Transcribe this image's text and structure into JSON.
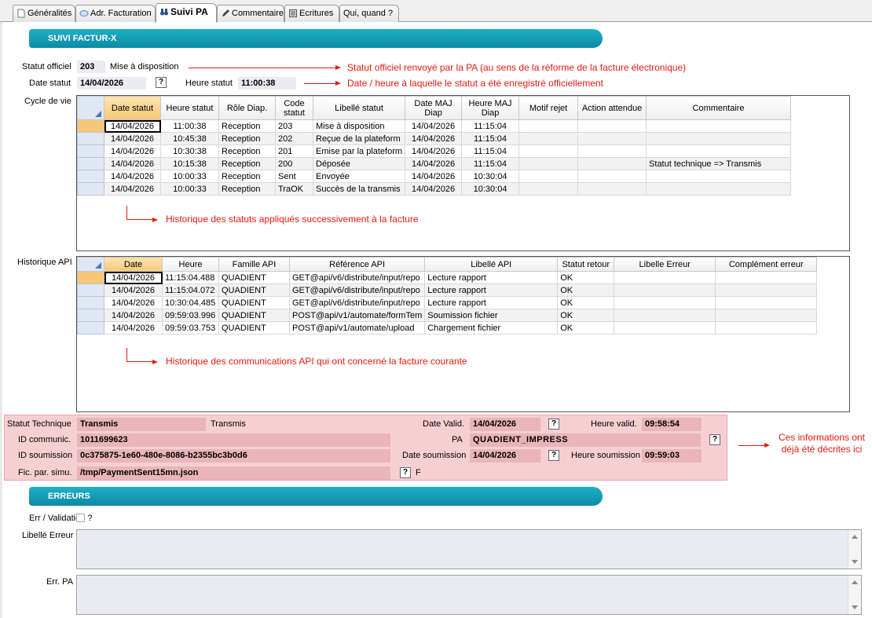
{
  "tabs": [
    {
      "label": "Généralités",
      "icon": "document-icon"
    },
    {
      "label": "Adr. Facturation",
      "icon": "address-icon"
    },
    {
      "label": "Suivi PA",
      "icon": "binoculars-icon"
    },
    {
      "label": "Commentaire",
      "icon": "pencil-icon"
    },
    {
      "label": "Ecritures",
      "icon": "ledger-icon"
    },
    {
      "label": "Qui, quand ?",
      "icon": ""
    }
  ],
  "suivi": {
    "banner": "SUIVI FACTUR-X",
    "statut_officiel_label": "Statut officiel",
    "statut_officiel_code": "203",
    "statut_officiel_text": "Mise à disposition",
    "date_statut_label": "Date statut",
    "date_statut_value": "14/04/2026",
    "heure_statut_label": "Heure statut",
    "heure_statut_value": "11:00:38",
    "help_glyph": "?"
  },
  "notes": {
    "statut_officiel": "Statut officiel renvoyé par la PA (au sens de la réforme de la facture électronique)",
    "date_heure": "Date / heure à laquelle le statut a été enregistré officiellement",
    "cycle": "Historique des statuts appliqués successivement à la facture",
    "api": "Historique des communications API qui ont concerné la facture courante",
    "already": "Ces informations ont déjà été décrites ici"
  },
  "cycle": {
    "label": "Cycle de vie",
    "headers": [
      "Date statut",
      "Heure statut",
      "Rôle Diap.",
      "Code statut",
      "Libellé statut",
      "Date MAJ Diap",
      "Heure MAJ Diap",
      "Motif rejet",
      "Action attendue",
      "Commentaire"
    ],
    "rows": [
      [
        "14/04/2026",
        "11:00:38",
        "Reception",
        "203",
        "Mise à disposition",
        "14/04/2026",
        "11:15:04",
        "",
        "",
        ""
      ],
      [
        "14/04/2026",
        "10:45:38",
        "Reception",
        "202",
        "Reçue de la plateform",
        "14/04/2026",
        "11:15:04",
        "",
        "",
        ""
      ],
      [
        "14/04/2026",
        "10:30:38",
        "Reception",
        "201",
        "Emise par la plateform",
        "14/04/2026",
        "11:15:04",
        "",
        "",
        ""
      ],
      [
        "14/04/2026",
        "10:15:38",
        "Reception",
        "200",
        "Déposée",
        "14/04/2026",
        "11:15:04",
        "",
        "",
        "Statut technique => Transmis"
      ],
      [
        "14/04/2026",
        "10:00:33",
        "Reception",
        "Sent",
        "Envoyée",
        "14/04/2026",
        "10:30:04",
        "",
        "",
        ""
      ],
      [
        "14/04/2026",
        "10:00:33",
        "Reception",
        "TraOK",
        "Succès de la transmis",
        "14/04/2026",
        "10:30:04",
        "",
        "",
        ""
      ]
    ]
  },
  "api": {
    "label": "Historique API",
    "headers": [
      "Date",
      "Heure",
      "Famille API",
      "Référence API",
      "Libellé API",
      "Statut retour",
      "Libelle Erreur",
      "Complément erreur"
    ],
    "rows": [
      [
        "14/04/2026",
        "11:15:04.488",
        "QUADIENT",
        "GET@api/v6/distribute/input/repo",
        "Lecture rapport",
        "OK",
        "",
        ""
      ],
      [
        "14/04/2026",
        "11:15:04.072",
        "QUADIENT",
        "GET@api/v6/distribute/input/repo",
        "Lecture rapport",
        "OK",
        "",
        ""
      ],
      [
        "14/04/2026",
        "10:30:04.485",
        "QUADIENT",
        "GET@api/v6/distribute/input/repo",
        "Lecture rapport",
        "OK",
        "",
        ""
      ],
      [
        "14/04/2026",
        "09:59:03.996",
        "QUADIENT",
        "POST@api/v1/automate/formTem",
        "Soumission fichier",
        "OK",
        "",
        ""
      ],
      [
        "14/04/2026",
        "09:59:03.753",
        "QUADIENT",
        "POST@api/v1/automate/upload",
        "Chargement fichier",
        "OK",
        "",
        ""
      ]
    ]
  },
  "tech": {
    "statut_technique_label": "Statut Technique",
    "statut_technique_value": "Transmis",
    "statut_technique_text": "Transmis",
    "date_valid_label": "Date Valid.",
    "date_valid_value": "14/04/2026",
    "heure_valid_label": "Heure valid.",
    "heure_valid_value": "09:58:54",
    "id_communic_label": "ID communic.",
    "id_communic_value": "1011699623",
    "pa_label": "PA",
    "pa_value": "QUADIENT_IMPRESS",
    "id_soumission_label": "ID soumission",
    "id_soumission_value": "0c375875-1e60-480e-8086-b2355bc3b0d6",
    "date_soumission_label": "Date soumission",
    "date_soumission_value": "14/04/2026",
    "heure_soumission_label": "Heure soumission",
    "heure_soumission_value": "09:59:03",
    "fic_label": "Fic. par. simu.",
    "fic_value": "/tmp/PaymentSent15mn.json",
    "fic_flag": "F"
  },
  "erreurs": {
    "banner": "ERREURS",
    "err_validation_label": "Err / Validation ?",
    "err_validation_checked": false,
    "libelle_erreur_label": "Libellé Erreur",
    "libelle_erreur_value": "",
    "err_pa_label": "Err. PA",
    "err_pa_value": ""
  },
  "colors": {
    "banner": "#0c8aa3",
    "note": "#e8190f",
    "pink_panel": "#f6cfd2"
  }
}
